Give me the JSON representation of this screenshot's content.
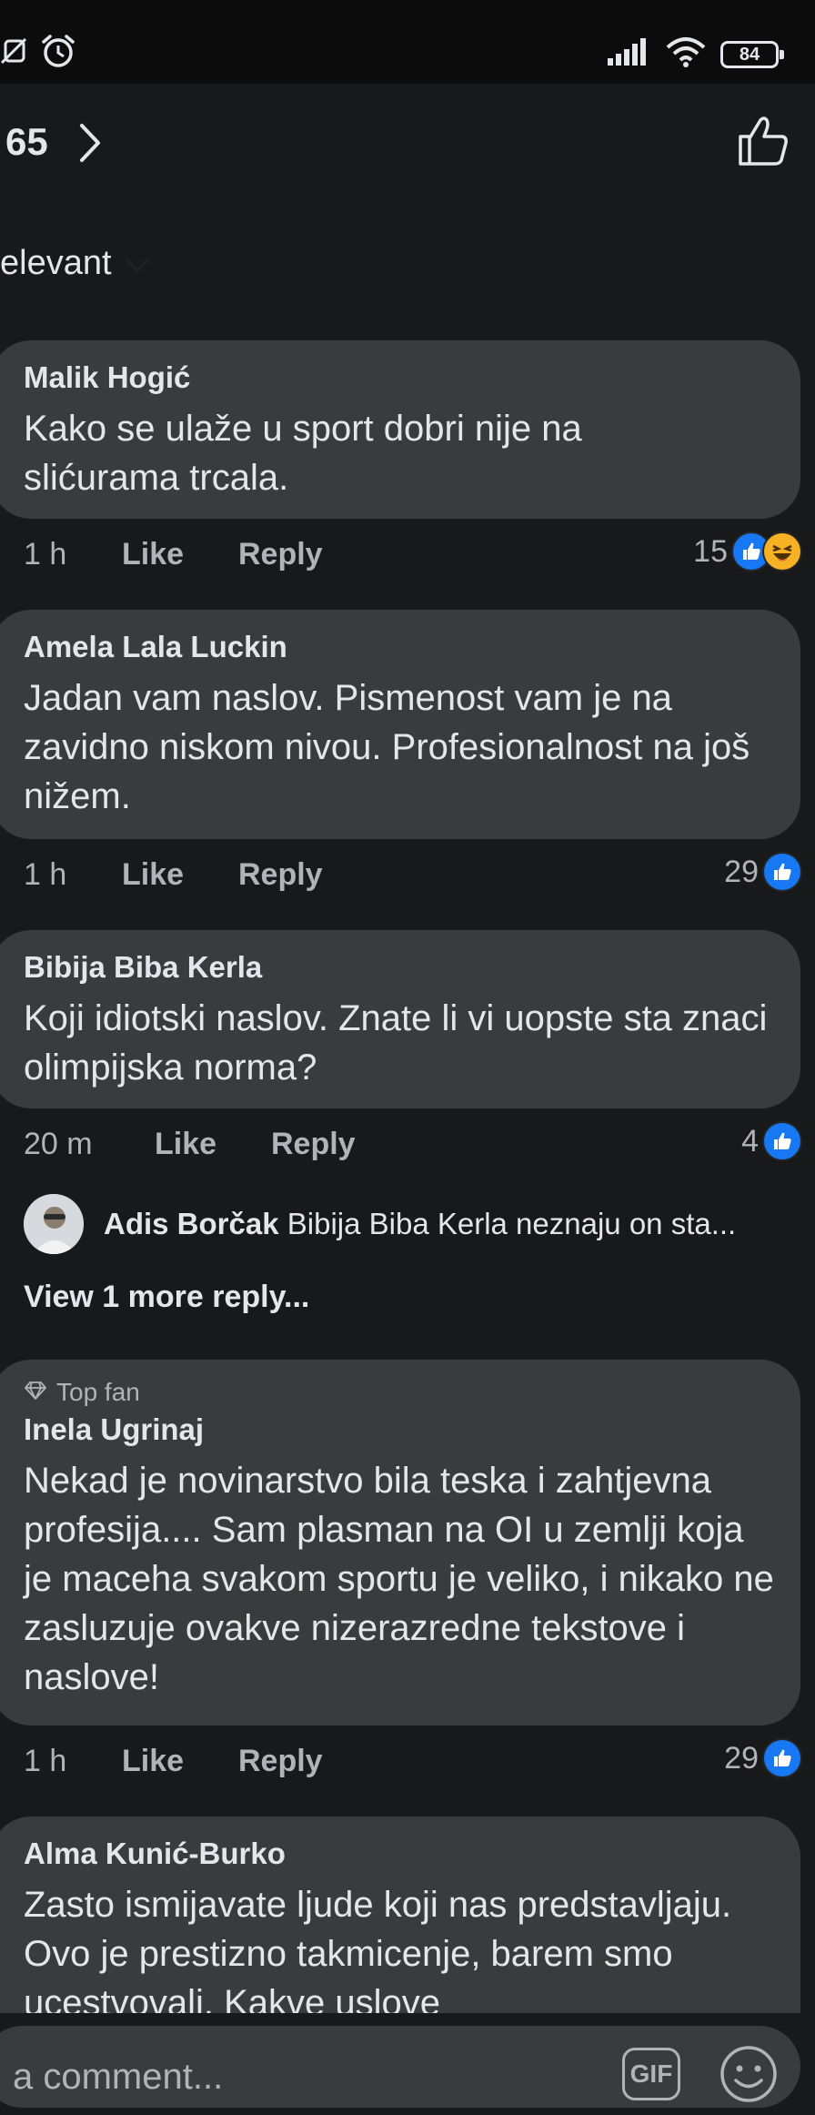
{
  "status_bar": {
    "battery": "84",
    "icons": [
      "do-not-disturb-icon",
      "alarm-icon",
      "signal-icon",
      "wifi-icon",
      "battery-icon"
    ]
  },
  "header": {
    "reaction_count": "65"
  },
  "sort": {
    "label": "elevant"
  },
  "comments": [
    {
      "author": "Malik Hogić",
      "text": "Kako se ulaže u sport dobri nije na slićurama trcala.",
      "time": "1 h",
      "like": "Like",
      "reply": "Reply",
      "reaction_count": "15",
      "reactions": [
        "like",
        "haha"
      ]
    },
    {
      "author": "Amela Lala Luckin",
      "text": "Jadan vam naslov. Pismenost vam je na zavidno niskom nivou. Profesionalnost na još nižem.",
      "time": "1 h",
      "like": "Like",
      "reply": "Reply",
      "reaction_count": "29",
      "reactions": [
        "like"
      ]
    },
    {
      "author": "Bibija Biba Kerla",
      "text": "Koji idiotski naslov. Znate li vi uopste sta znaci olimpijska norma?",
      "time": "20 m",
      "like": "Like",
      "reply": "Reply",
      "reaction_count": "4",
      "reactions": [
        "like"
      ]
    },
    {
      "badge": "Top fan",
      "author": "Inela Ugrinaj",
      "text": "Nekad je novinarstvo bila teska i zahtjevna profesija.... Sam plasman na OI u zemlji koja je maceha svakom sportu je veliko, i nikako ne zasluzuje ovakve nizerazredne tekstove i naslove!",
      "time": "1 h",
      "like": "Like",
      "reply": "Reply",
      "reaction_count": "29",
      "reactions": [
        "like"
      ]
    },
    {
      "author": "Alma Kunić-Burko",
      "text": "Zasto ismijavate ljude koji nas predstavljaju. Ovo je prestizno takmicenje, barem smo ucestvovali. Kakve uslove"
    }
  ],
  "reply_preview": {
    "author": "Adis Borčak",
    "text": "Bibija Biba Kerla neznaju on sta..."
  },
  "view_more": "View 1 more reply...",
  "composer": {
    "placeholder": "a comment...",
    "gif_label": "GIF"
  },
  "colors": {
    "background": "#18191a",
    "bubble": "#3a3b3c",
    "accent": "#1877f2"
  }
}
